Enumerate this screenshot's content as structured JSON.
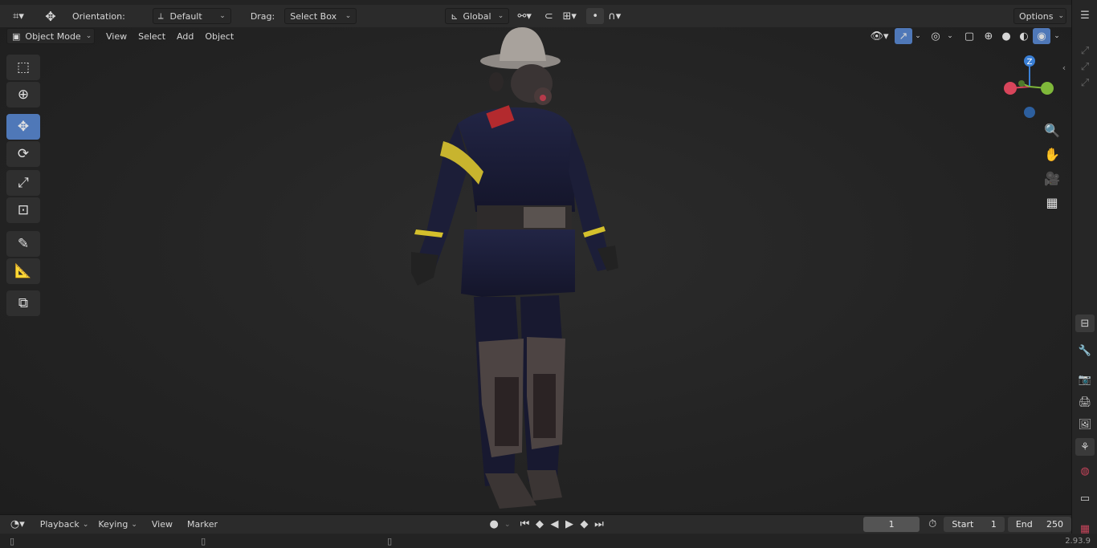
{
  "header": {
    "orientation_label": "Orientation:",
    "orientation_value": "Default",
    "drag_label": "Drag:",
    "drag_value": "Select Box",
    "transform_space": "Global",
    "options_label": "Options"
  },
  "view_header": {
    "mode": "Object Mode",
    "menus": [
      "View",
      "Select",
      "Add",
      "Object"
    ]
  },
  "gizmo": {
    "z_label": "Z"
  },
  "timeline": {
    "menus": [
      "Playback",
      "Keying",
      "View",
      "Marker"
    ],
    "current_frame": "1",
    "start_label": "Start",
    "start_value": "1",
    "end_label": "End",
    "end_value": "250"
  },
  "status": {
    "version": "2.93.9"
  },
  "colors": {
    "accent": "#4f78b8",
    "axis_x": "#d8455b",
    "axis_y": "#7fb83a",
    "axis_z": "#3a7fd5"
  }
}
